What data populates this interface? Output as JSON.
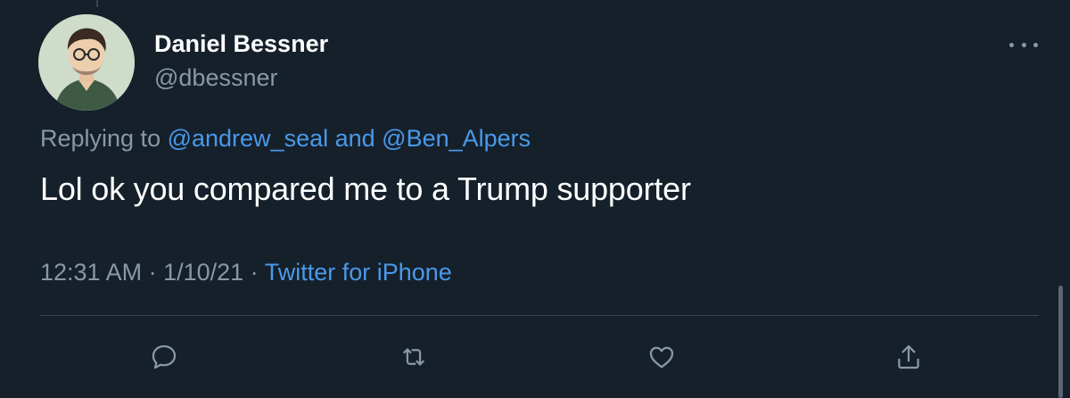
{
  "tweet": {
    "author": {
      "display_name": "Daniel Bessner",
      "handle": "@dbessner",
      "avatar_icon": "avatar-illustration"
    },
    "replying": {
      "prefix": "Replying to ",
      "user1": "@andrew_seal",
      "conjunction": " and ",
      "user2": "@Ben_Alpers"
    },
    "text": "Lol ok you compared me to a Trump supporter",
    "time": "12:31 AM",
    "sep1": " · ",
    "date": "1/10/21",
    "sep2": " · ",
    "source": "Twitter for iPhone"
  },
  "actions": [
    {
      "name": "reply",
      "icon": "reply-icon"
    },
    {
      "name": "retweet",
      "icon": "retweet-icon"
    },
    {
      "name": "like",
      "icon": "heart-icon"
    },
    {
      "name": "share",
      "icon": "share-icon"
    }
  ],
  "colors": {
    "background": "#15202b",
    "secondary_text": "#8899a6",
    "link": "#4a99e9",
    "divider": "#38444d"
  }
}
